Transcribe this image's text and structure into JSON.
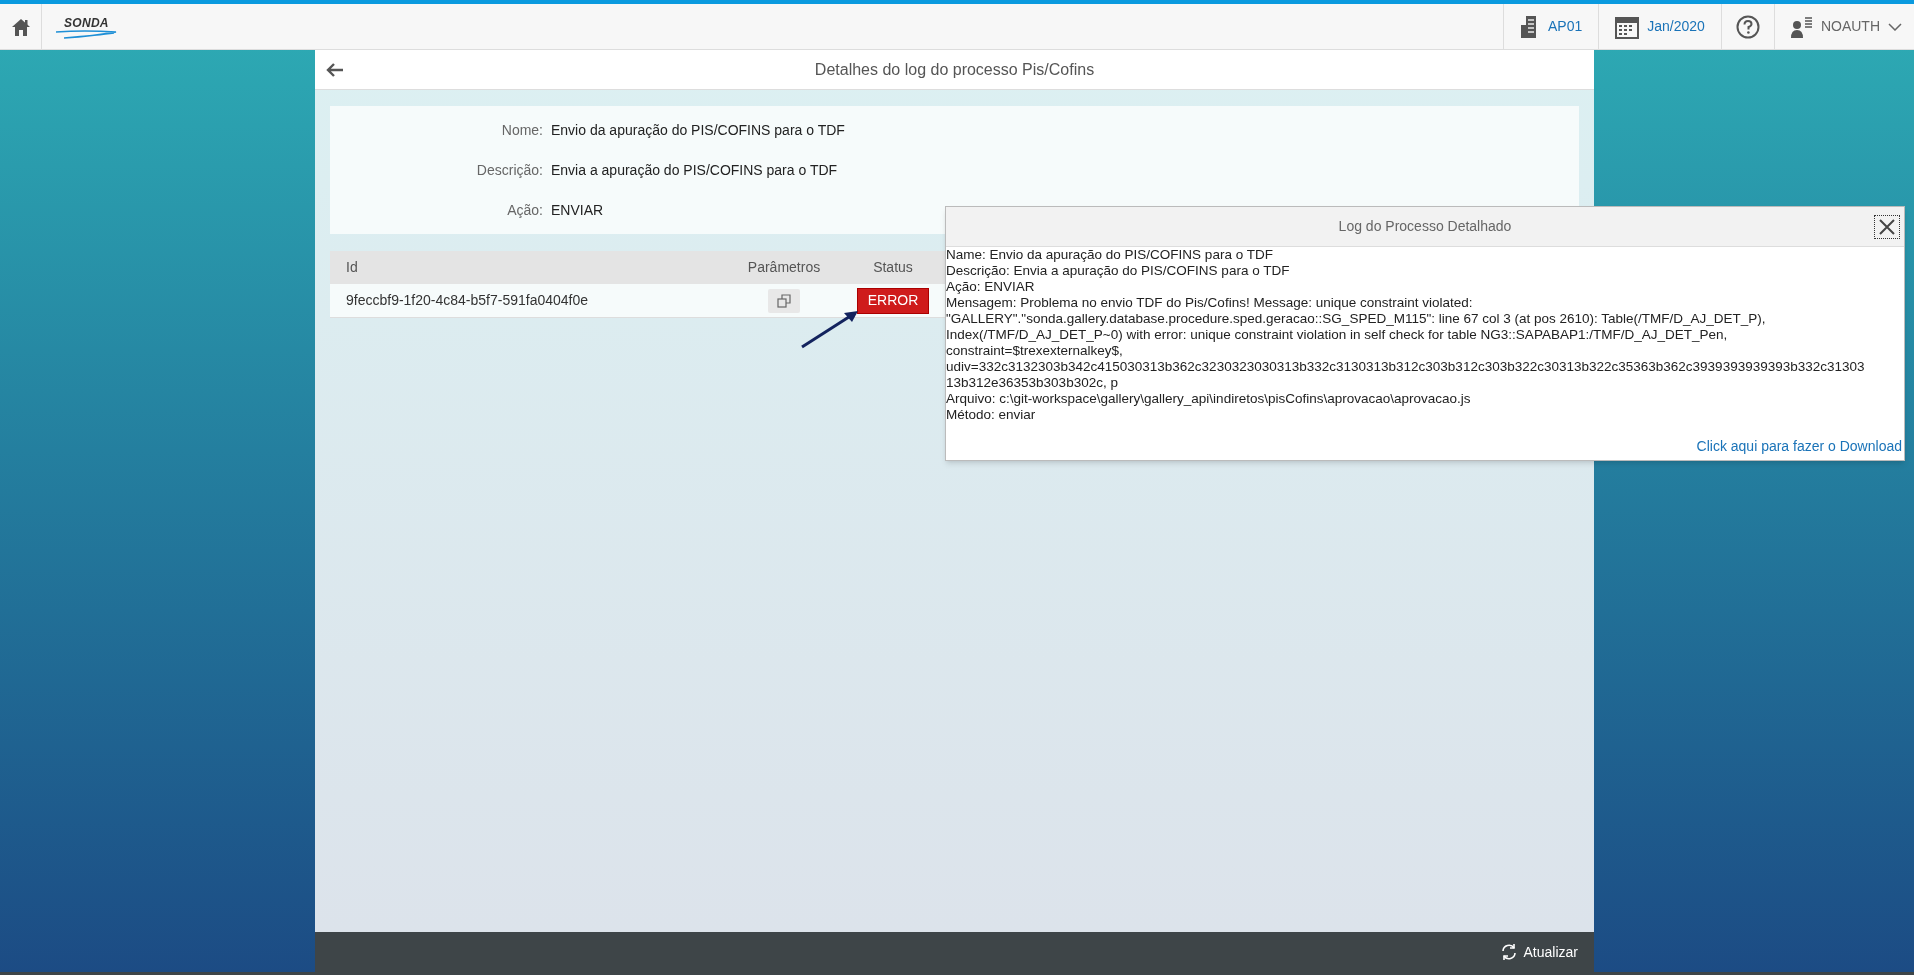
{
  "topbar": {
    "logo": "SONDA",
    "company": "AP01",
    "period": "Jan/2020",
    "user": "NOAUTH"
  },
  "page": {
    "title": "Detalhes do log do processo Pis/Cofins"
  },
  "fields": [
    {
      "label": "Nome:",
      "value": "Envio da apuração do PIS/COFINS para o TDF"
    },
    {
      "label": "Descrição:",
      "value": "Envia a apuração do PIS/COFINS para o TDF"
    },
    {
      "label": "Ação:",
      "value": "ENVIAR"
    }
  ],
  "table": {
    "columns": [
      "Id",
      "Parâmetros",
      "Status"
    ],
    "rows": [
      {
        "id": "9feccbf9-1f20-4c84-b5f7-591fa0404f0e",
        "status": "ERROR"
      }
    ]
  },
  "dialog": {
    "title": "Log do Processo Detalhado",
    "lines": [
      "Name: Envio da apuração do PIS/COFINS para o TDF",
      "Descrição: Envia a apuração do PIS/COFINS para o TDF",
      "Ação: ENVIAR",
      "Mensagem: Problema no envio TDF do Pis/Cofins! Message: unique constraint violated:",
      "\"GALLERY\".\"sonda.gallery.database.procedure.sped.geracao::SG_SPED_M115\": line 67 col 3 (at pos 2610): Table(/TMF/D_AJ_DET_P),",
      "Index(/TMF/D_AJ_DET_P~0) with error: unique constraint violation in self check for table NG3::SAPABAP1:/TMF/D_AJ_DET_Pen,",
      "constraint=$trexexternalkey$,",
      "udiv=332c3132303b342c415030313b362c3230323030313b332c3130313b312c303b312c303b322c30313b322c35363b362c3939393939393b332c31303",
      "13b312e36353b303b302c, p",
      "Arquivo: c:\\git-workspace\\gallery\\gallery_api\\indiretos\\pisCofins\\aprovacao\\aprovacao.js",
      "Método: enviar"
    ],
    "download_link": "Click aqui para fazer o Download"
  },
  "footer": {
    "refresh": "Atualizar"
  }
}
